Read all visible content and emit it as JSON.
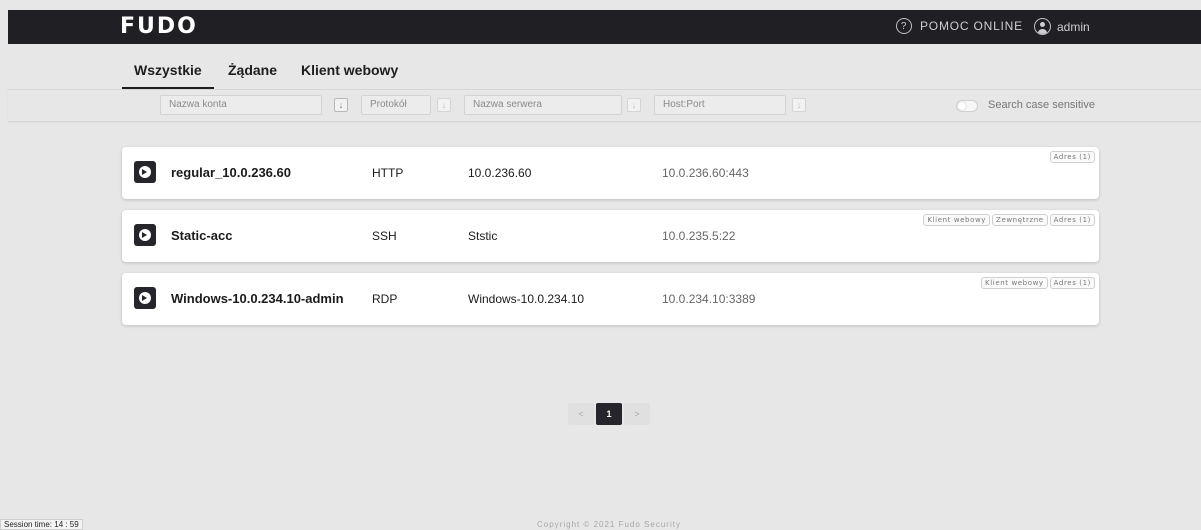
{
  "header": {
    "logo": "FUDO",
    "help_icon_glyph": "?",
    "help_label": "POMOC ONLINE",
    "user_label": "admin"
  },
  "tabs": [
    {
      "label": "Wszystkie",
      "active": true
    },
    {
      "label": "Żądane",
      "active": false
    },
    {
      "label": "Klient webowy",
      "active": false
    }
  ],
  "filters": {
    "account_placeholder": "Nazwa konta",
    "protocol_placeholder": "Protokół",
    "server_placeholder": "Nazwa serwera",
    "hostport_placeholder": "Host:Port",
    "sort_glyph": "↓",
    "case_sensitive_label": "Search case sensitive"
  },
  "accounts": [
    {
      "name": "regular_10.0.236.60",
      "protocol": "HTTP",
      "server": "10.0.236.60",
      "host": "10.0.236.60:443",
      "badges": [
        "Adres (1)"
      ]
    },
    {
      "name": "Static-acc",
      "protocol": "SSH",
      "server": "Ststic",
      "host": "10.0.235.5:22",
      "badges": [
        "Klient webowy",
        "Zewnętrzne",
        "Adres (1)"
      ]
    },
    {
      "name": "Windows-10.0.234.10-admin",
      "protocol": "RDP",
      "server": "Windows-10.0.234.10",
      "host": "10.0.234.10:3389",
      "badges": [
        "Klient webowy",
        "Adres (1)"
      ]
    }
  ],
  "pagination": {
    "prev": "<",
    "current": "1",
    "next": ">"
  },
  "footer": {
    "session": "Session time: 14 : 59",
    "copyright": "Copyright © 2021 Fudo Security"
  },
  "colors": {
    "topbar": "#1f1f24",
    "background": "#e8e7e7",
    "accent": "#25252b"
  }
}
